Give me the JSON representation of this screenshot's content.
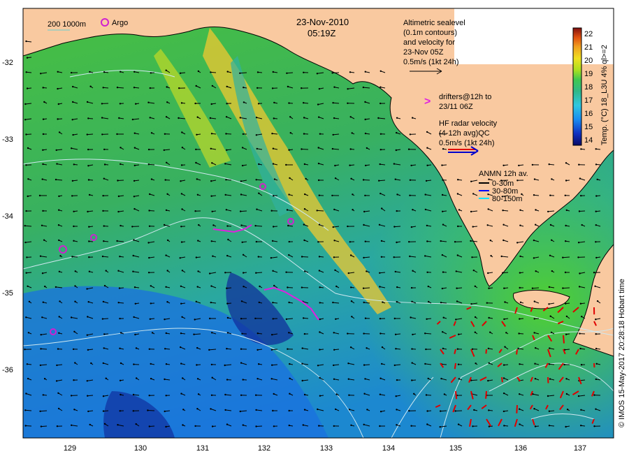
{
  "header": {
    "date": "23-Nov-2010",
    "time": "05:19Z"
  },
  "legend_top_left": {
    "contour_label": "200  1000m",
    "argo_label": "Argo"
  },
  "altimetry_note": {
    "lines": [
      "Altimetric sealevel",
      "(0.1m contours)",
      "and velocity for",
      "23-Nov 05Z",
      "0.5m/s (1kt 24h)"
    ]
  },
  "drifters_note": {
    "symbol": ">",
    "lines": [
      "drifters@12h to",
      "23/11 06Z"
    ]
  },
  "hf_radar_note": {
    "lines": [
      "HF radar velocity",
      "(4-12h avg)QC",
      "0.5m/s (1kt 24h)"
    ]
  },
  "anmn_note": {
    "title": "ANMN 12h av.",
    "items": [
      {
        "label": "0-30m",
        "color": "#000000"
      },
      {
        "label": "30-80m",
        "color": "#0000ff"
      },
      {
        "label": "80-150m",
        "color": "#00e5ff"
      }
    ]
  },
  "colorbar": {
    "title": "Temp. (°C) 18_L3U 4% ql>=2",
    "ticks": [
      "22",
      "21",
      "20",
      "19",
      "18",
      "17",
      "16",
      "15",
      "14"
    ],
    "min": 13.5,
    "max": 22.5
  },
  "credit": "© IMOS 15-May-2017 20:28:18 Hobart time",
  "axes": {
    "x_ticks": [
      "129",
      "130",
      "131",
      "132",
      "133",
      "134",
      "135",
      "136",
      "137"
    ],
    "y_ticks": [
      "-32",
      "-33",
      "-34",
      "-35",
      "-36"
    ],
    "lon_range": [
      128.2,
      137.5
    ],
    "lat_range": [
      -36.95,
      -31.05
    ]
  },
  "colors": {
    "land": "#f9c9a0",
    "contour": "#cfe8f0"
  }
}
